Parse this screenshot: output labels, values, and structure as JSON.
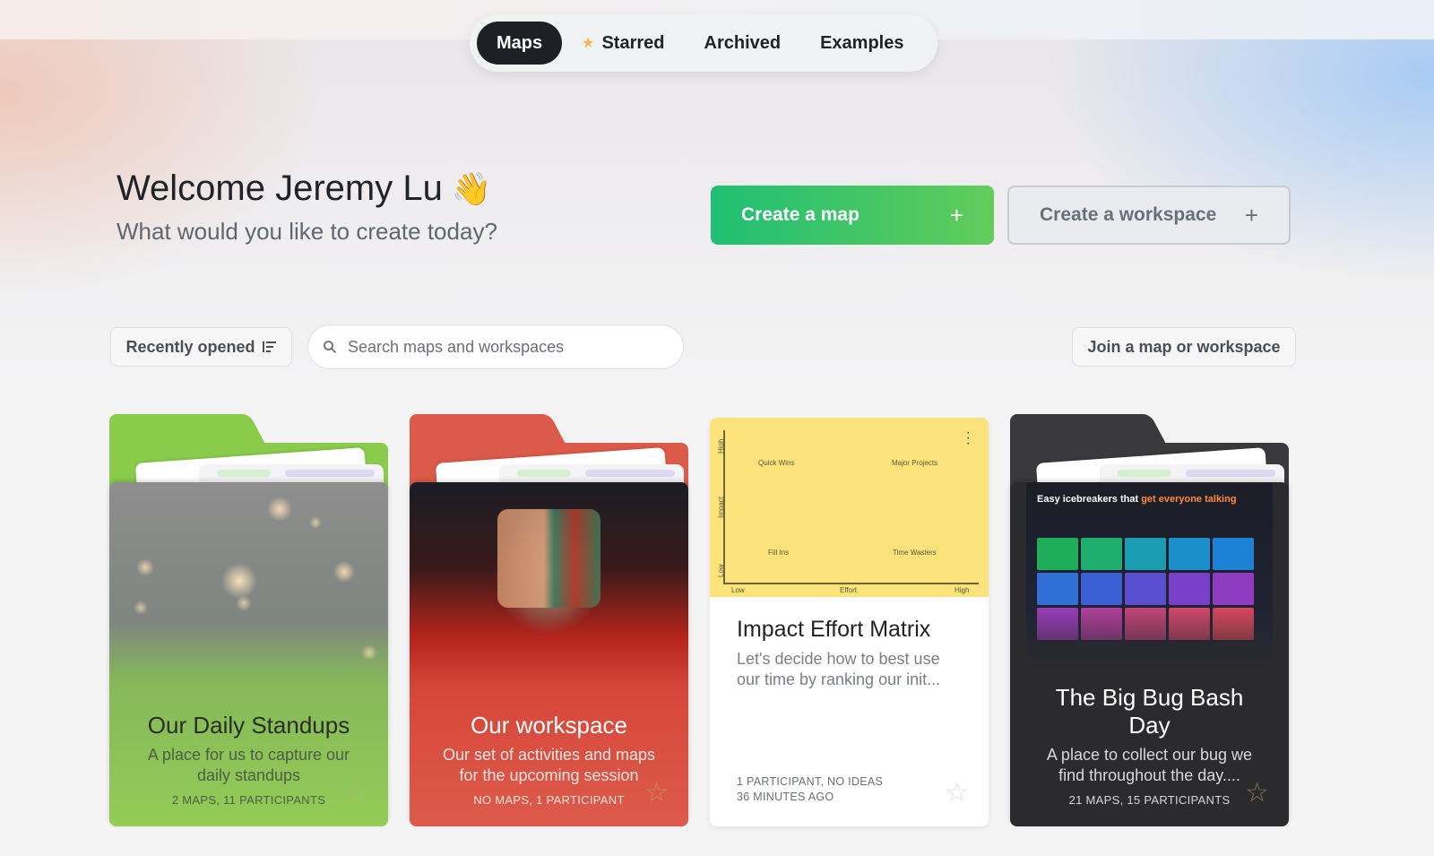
{
  "nav": {
    "tabs": [
      {
        "label": "Maps",
        "active": true
      },
      {
        "label": "Starred",
        "active": false,
        "icon": "star-icon"
      },
      {
        "label": "Archived",
        "active": false
      },
      {
        "label": "Examples",
        "active": false
      }
    ]
  },
  "welcome": {
    "title": "Welcome Jeremy Lu",
    "emoji": "👋",
    "subtitle": "What would you like to create today?"
  },
  "actions": {
    "create_map": "Create a map",
    "create_workspace": "Create a workspace",
    "plus": "+"
  },
  "toolbar": {
    "sort_label": "Recently opened",
    "search_placeholder": "Search maps and workspaces",
    "join_label": "Join a map or workspace"
  },
  "cards": [
    {
      "title": "Our Daily Standups",
      "description": "A place for us to capture our daily standups",
      "meta": "2 MAPS, 11 PARTICIPANTS",
      "color": "#8bcb4c"
    },
    {
      "title": "Our workspace",
      "description": "Our set of activities and maps for the upcoming session",
      "meta": "NO MAPS, 1 PARTICIPANT",
      "color": "#db5a4a"
    },
    {
      "title": "Impact Effort Matrix",
      "description": "Let's decide how to best use our time by ranking our init...",
      "meta_line1": "1 PARTICIPANT, NO IDEAS",
      "meta_line2": "36 MINUTES AGO",
      "color": "#fbe27a",
      "matrix": {
        "quadrants": [
          "Quick Wins",
          "Major Projects",
          "Fill Ins",
          "Time Wasters"
        ],
        "x_axis": "Effort",
        "x_low": "Low",
        "x_high": "High",
        "y_axis": "Impact",
        "y_low": "Low",
        "y_high": "High"
      }
    },
    {
      "title": "The Big Bug Bash Day",
      "description": "A place to collect our bug we find throughout the day....",
      "meta": "21 MAPS, 15 PARTICIPANTS",
      "color": "#3a3a3c",
      "preview_title_a": "Easy icebreakers that ",
      "preview_title_b": "get everyone talking"
    }
  ],
  "colors": {
    "accent_green": "#1fbf74",
    "dark_tab": "#1d2126"
  }
}
